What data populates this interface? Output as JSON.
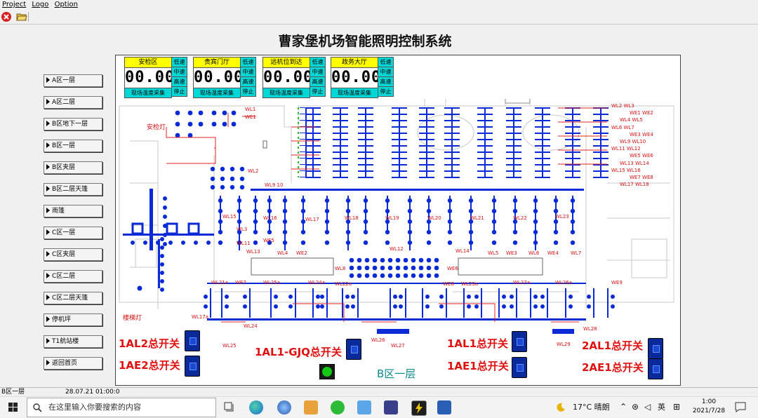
{
  "menu": {
    "project": "Project",
    "logo": "Logo",
    "option": "Option"
  },
  "toolbar": {
    "close_icon": "close-icon",
    "open_icon": "open-folder-icon"
  },
  "app": {
    "title": "曹家堡机场智能照明控制系统"
  },
  "nav": [
    "A区一层",
    "A区二层",
    "B区地下一层",
    "B区一层",
    "B区夹层",
    "B区二层天篷",
    "雨篷",
    "C区一层",
    "C区夹层",
    "C区二层",
    "C区二层天篷",
    "停机坪",
    "T1航站楼",
    "返回首页"
  ],
  "zones": [
    {
      "name": "安检区",
      "display": "00.00",
      "speeds": [
        "低速",
        "中速",
        "高速",
        "停止"
      ],
      "footer": "现场温度采集"
    },
    {
      "name": "贵宾门厅",
      "display": "00.00",
      "speeds": [
        "低速",
        "中速",
        "高速",
        "停止"
      ],
      "footer": "现场温度采集"
    },
    {
      "name": "远机位到达",
      "display": "00.00",
      "speeds": [
        "低速",
        "中速",
        "高速",
        "停止"
      ],
      "footer": "现场温度采集"
    },
    {
      "name": "政务大厅",
      "display": "00.00",
      "speeds": [
        "低速",
        "中速",
        "高速",
        "停止"
      ],
      "footer": "现场温度采集"
    }
  ],
  "map_labels": {
    "security_light": "安检灯",
    "stair_light": "楼梯灯",
    "wl1": "WL1",
    "we1": "WE1",
    "wl2": "WL2",
    "wl9_10": "WL9 10",
    "wl15": "WL15",
    "wl3": "WL3",
    "wl11": "WL11",
    "wl13": "WL13",
    "we5": "WE5",
    "wl16": "WL16",
    "wl4": "WL4",
    "we2": "WE2",
    "wl17": "WL17",
    "wl18": "WL18",
    "wl19": "WL19",
    "wl12": "WL12",
    "wl20": "WL20",
    "wl21": "WL21",
    "wl14": "WL14",
    "wl5": "WL5",
    "we3": "WE3",
    "wl22": "WL22",
    "wl6": "WL6",
    "wl23": "WL23",
    "we4": "WE4",
    "wl7": "WL7",
    "wl8": "WL8",
    "we6": "WE6",
    "wl21a": "WL21a",
    "we7": "WE7",
    "wl25a": "WL25a",
    "wl24a": "WL24a",
    "wl22a": "WL22a",
    "we8": "WE8",
    "wl23a": "WL23a",
    "wl27a": "WL27a",
    "wl26a": "WL26a",
    "we9": "WE9",
    "wl17a": "WL17a",
    "wl24": "WL24",
    "wl25": "WL25",
    "wl26": "WL26",
    "wl27": "WL27",
    "wl28": "WL28",
    "wl29": "WL29",
    "right_list": [
      "WL2 WL3",
      "WE1 WE2",
      "WL4 WL5",
      "WL6 WL7",
      "WE3 WE4",
      "WL9 WL10",
      "WL11 WL12",
      "WE5 WE6",
      "WL13 WL14",
      "WL15 WL16",
      "WE7 WE8",
      "WL17 WL18"
    ]
  },
  "switches": {
    "al2": "1AL2总开关",
    "ae2": "1AE2总开关",
    "gjq": "1AL1-GJQ总开关",
    "al1": "1AL1总开关",
    "ae1": "1AE1总开关",
    "al1_2": "2AL1总开关",
    "ae1_2": "2AE1总开关"
  },
  "floor_label": "B区一层",
  "status": {
    "page": "B区一层",
    "datetime": "28.07.21 01:00:0"
  },
  "taskbar": {
    "search_placeholder": "在这里输入你要搜索的内容",
    "weather": "17°C 晴朗",
    "ime": "英",
    "time": "1:00",
    "date": "2021/7/28"
  },
  "colors": {
    "accent_blue": "#0a2ad8",
    "label_red": "#e01010",
    "zone_yellow": "#ffff00",
    "zone_cyan": "#00d8d8"
  }
}
